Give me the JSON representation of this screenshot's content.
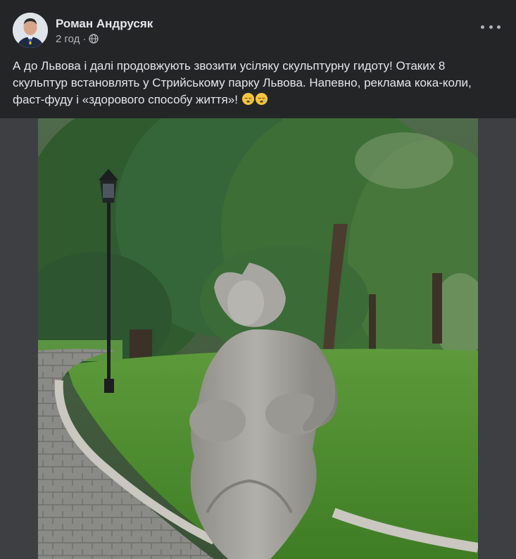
{
  "post": {
    "author": "Роман Андрусяк",
    "timestamp": "2 год",
    "separator": "·",
    "privacy_icon": "globe-icon",
    "more_icon": "more-horizontal-icon",
    "text": "А до Львова і далі продовжують звозити усіляку скульптурну гидоту! Отаких 8 скульптур встановлять у Стрийському парку Львова. Напевно, реклама кока-коли, фаст-фуду і «здорового способу життя»!",
    "emojis": [
      "sleepy-face-emoji",
      "sleepy-face-emoji"
    ]
  },
  "photo": {
    "subject": "photo of a stone sculpture of a plump woman in a park"
  },
  "colors": {
    "card_bg": "#242526",
    "text_primary": "#e4e6eb",
    "text_secondary": "#b0b3b8",
    "media_bg": "#3e3f42"
  }
}
